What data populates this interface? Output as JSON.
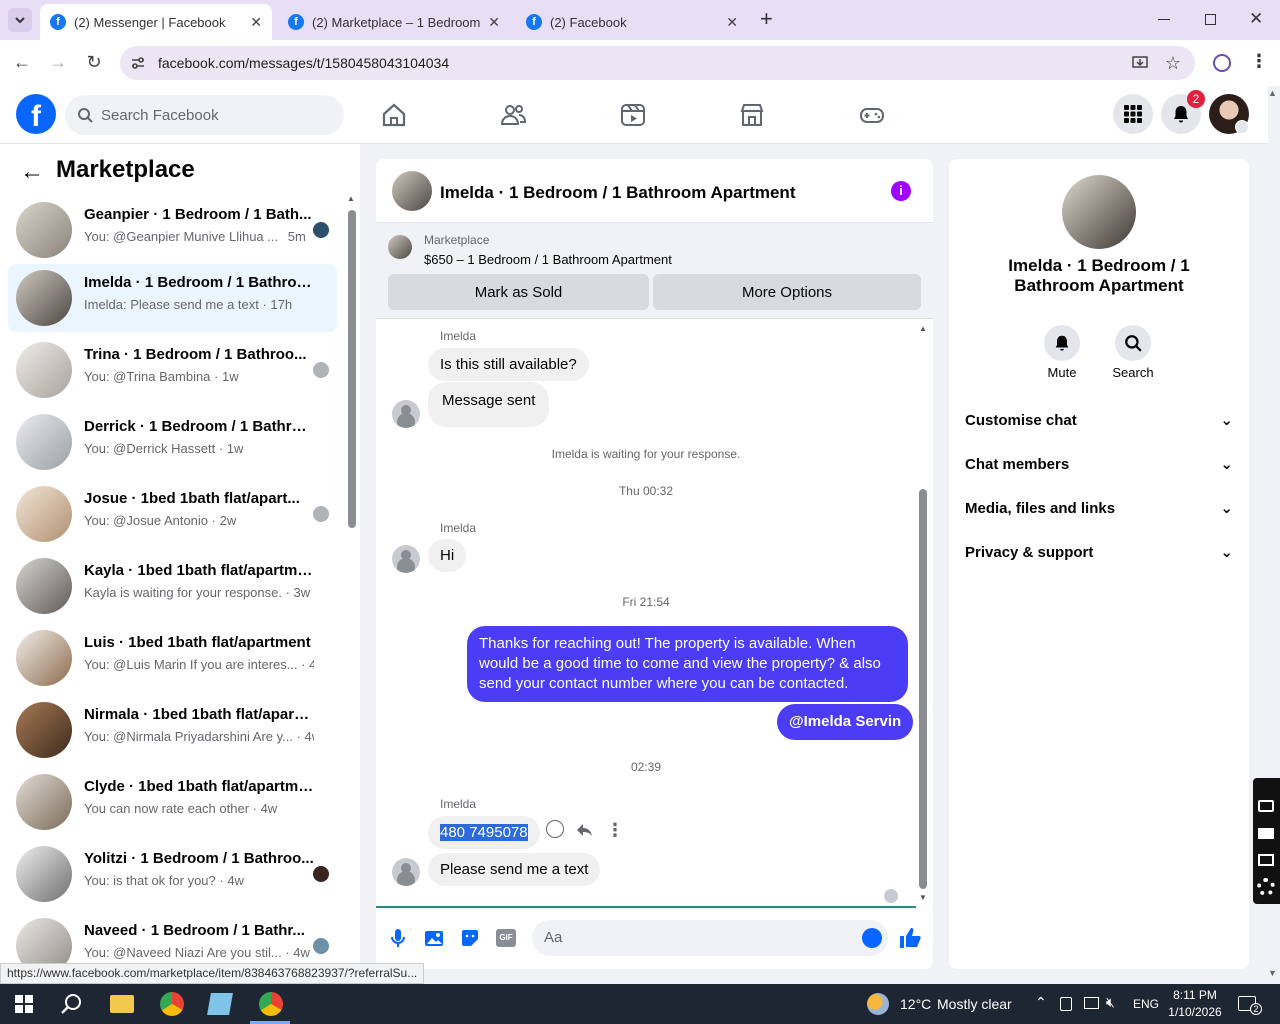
{
  "browser": {
    "tabs": [
      {
        "title": "(2) Messenger | Facebook",
        "close": "✕"
      },
      {
        "title": "(2) Marketplace – 1 Bedroom /",
        "close": "✕"
      },
      {
        "title": "(2) Facebook",
        "close": "✕"
      }
    ],
    "new_tab": "+",
    "url": "facebook.com/messages/t/1580458043104034",
    "status_url": "https://www.facebook.com/marketplace/item/838463768823937/?referralSu..."
  },
  "header": {
    "search_placeholder": "Search Facebook",
    "notification_count": "2"
  },
  "left": {
    "title": "Marketplace",
    "conversations": [
      {
        "name": "Geanpier · 1 Bedroom / 1 Bath...",
        "preview": "You: @Geanpier Munive Llihua ...",
        "time": "5m"
      },
      {
        "name": "Imelda · 1 Bedroom / 1 Bathroo...",
        "preview": "Imelda: Please send me a text · 17h",
        "time": ""
      },
      {
        "name": "Trina · 1 Bedroom / 1 Bathroo...",
        "preview": "You: @Trina Bambina · 1w",
        "time": ""
      },
      {
        "name": "Derrick · 1 Bedroom / 1 Bathroo...",
        "preview": "You: @Derrick Hassett · 1w",
        "time": ""
      },
      {
        "name": "Josue · 1bed 1bath flat/apart...",
        "preview": "You: @Josue Antonio · 2w",
        "time": ""
      },
      {
        "name": "Kayla · 1bed 1bath flat/apartment",
        "preview": "Kayla is waiting for your response. · 3w",
        "time": ""
      },
      {
        "name": "Luis · 1bed 1bath flat/apartment",
        "preview": "You: @Luis Marin If you are interes... · 4w",
        "time": ""
      },
      {
        "name": "Nirmala · 1bed 1bath flat/apartm...",
        "preview": "You: @Nirmala Priyadarshini Are y... · 4w",
        "time": ""
      },
      {
        "name": "Clyde · 1bed 1bath flat/apartment",
        "preview": "You can now rate each other · 4w",
        "time": ""
      },
      {
        "name": "Yolitzi · 1 Bedroom / 1 Bathroo...",
        "preview": "You: is that ok for you? · 4w",
        "time": ""
      },
      {
        "name": "Naveed · 1 Bedroom / 1 Bathr...",
        "preview": "You: @Naveed Niazi Are you stil... · 4w",
        "time": ""
      }
    ]
  },
  "chat": {
    "title": "Imelda · 1 Bedroom / 1 Bathroom Apartment",
    "marketplace_label": "Marketplace",
    "listing": "$650 – 1 Bedroom / 1 Bathroom Apartment",
    "mark_sold": "Mark as Sold",
    "more_options": "More Options",
    "sender": "Imelda",
    "msg1": "Is this still available?",
    "msg2": "Message sent",
    "waiting": "Imelda is waiting for your response.",
    "stamp1": "Thu 00:32",
    "msg3": "Hi",
    "stamp2": "Fri 21:54",
    "out1": "Thanks for reaching out! The property is available. When would be a good time to come and view the property? & also send your contact number where you can be contacted.",
    "out2": "@Imelda Servin",
    "stamp3": "02:39",
    "msg4": "480 7495078",
    "msg5": "Please send me a text",
    "composer_placeholder": "Aa"
  },
  "right": {
    "title": "Imelda · 1 Bedroom / 1 Bathroom Apartment",
    "mute": "Mute",
    "search": "Search",
    "rows": [
      "Customise chat",
      "Chat members",
      "Media, files and links",
      "Privacy & support"
    ]
  },
  "taskbar": {
    "weather_temp": "12°C",
    "weather_text": "Mostly clear",
    "lang": "ENG",
    "time": "8:11 PM",
    "date": "1/10/2026",
    "notif": "2"
  }
}
